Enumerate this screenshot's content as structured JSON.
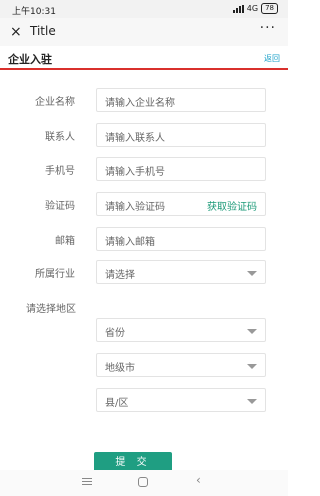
{
  "status_bar": {
    "time": "上午10:31",
    "network": "4G",
    "battery": "78"
  },
  "title_bar": {
    "close_glyph": "×",
    "title": "Title",
    "more_glyph": "···"
  },
  "header": {
    "title": "企业入驻",
    "back_label": "返回"
  },
  "form": {
    "company_name": {
      "label": "企业名称",
      "placeholder": "请输入企业名称"
    },
    "contact": {
      "label": "联系人",
      "placeholder": "请输入联系人"
    },
    "phone": {
      "label": "手机号",
      "placeholder": "请输入手机号"
    },
    "code": {
      "label": "验证码",
      "placeholder": "请输入验证码",
      "action": "获取验证码"
    },
    "email": {
      "label": "邮箱",
      "placeholder": "请输入邮箱"
    },
    "industry": {
      "label": "所属行业",
      "selected": "请选择"
    }
  },
  "region": {
    "label": "请选择地区",
    "province": "省份",
    "city": "地级市",
    "county": "县/区"
  },
  "submit_label": "提 交",
  "colors": {
    "accent": "#1f9e82",
    "header_rule": "#d9302c",
    "back_link": "#1aa0c8"
  }
}
